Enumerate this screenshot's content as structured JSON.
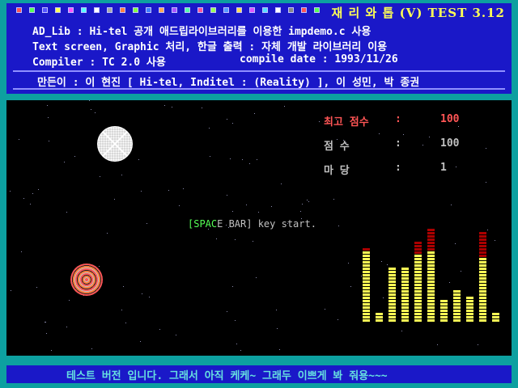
{
  "title_bar": {
    "title": "재 리 와 톱 (V) TEST 3.12",
    "swatch_colors": [
      "#ff5555",
      "#55ff55",
      "#5555ff",
      "#ffff55",
      "#ff55ff",
      "#55ffff",
      "#ffffff",
      "#aaaaaa",
      "#ff8040",
      "#80ff40",
      "#4080ff",
      "#ffaa55",
      "#aa55ff",
      "#55ffaa",
      "#ff5599",
      "#99ff55",
      "#5599ff",
      "#ffdd55",
      "#dd55ff",
      "#55ddff",
      "#ffffff",
      "#888888",
      "#ff5555",
      "#55ff55"
    ]
  },
  "info": {
    "line1": "AD_Lib : Hi-tel 공개 애드립라이브러리를 이용한 impdemo.c 사용",
    "line2": "Text screen, Graphic 처리, 한글 출력 : 자체 개발 라이브러리 이용",
    "line3_compiler": "Compiler : TC 2.0 사용",
    "line3_date": "compile date : 1993/11/26",
    "credits": "만든이 : 이 현진 [ Hi-tel, Inditel : (Reality) ], 이 성민, 박 종권"
  },
  "game": {
    "stats": [
      {
        "label": "최고 점수",
        "colon": ":",
        "value": "100",
        "color": "#ff5555"
      },
      {
        "label": "점    수",
        "colon": ":",
        "value": "100",
        "color": "#c0c0c0"
      },
      {
        "label": "마    당",
        "colon": ":",
        "value": "1",
        "color": "#c0c0c0"
      }
    ],
    "prompt_highlight": "[SPAC",
    "prompt_rest": "E BAR] key start.",
    "equalizer": {
      "yellow_segments": [
        22,
        3,
        17,
        17,
        21,
        22,
        7,
        10,
        8,
        20,
        3
      ],
      "red_segments": [
        1,
        0,
        0,
        0,
        4,
        7,
        0,
        0,
        0,
        8,
        0
      ],
      "colors": {
        "low": "#ffff55",
        "high": "#aa0000"
      }
    }
  },
  "footer": {
    "message": "테스트 버전 입니다. 그래서 아직 케케~ 그래두 이쁘게 봐 줘용~~~"
  }
}
